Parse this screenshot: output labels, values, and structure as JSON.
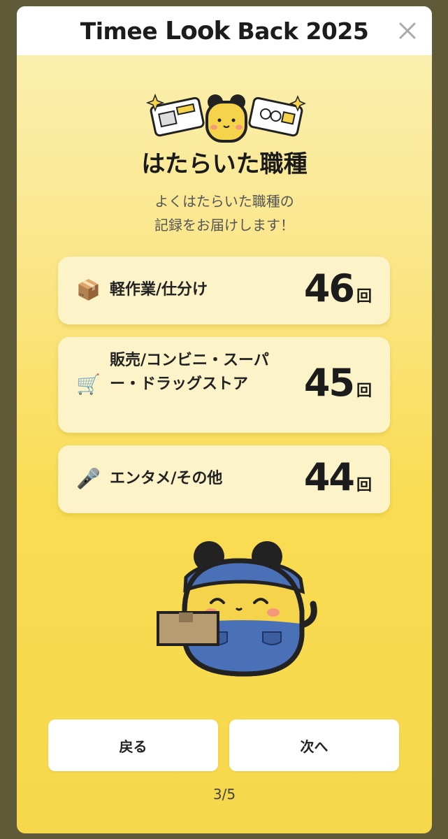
{
  "header": {
    "logo_part1": "Timee ",
    "logo_part2": "Look",
    "logo_part3": " Back ",
    "logo_year": "2025",
    "close_label": "×"
  },
  "section": {
    "title": "はたらいた職種",
    "subtitle": "よくはたらいた職種の\n記録をお届けします！"
  },
  "jobs": [
    {
      "icon": "📦",
      "icon_name": "package-icon",
      "label": "軽作業/仕分け",
      "count": "46",
      "unit": "回"
    },
    {
      "icon": "🛒",
      "icon_name": "shopping-cart-icon",
      "label": "販売/コンビニ・スーパー・ドラッグストア",
      "count": "45",
      "unit": "回"
    },
    {
      "icon": "🎤",
      "icon_name": "microphone-icon",
      "label": "エンタメ/その他",
      "count": "44",
      "unit": "回"
    }
  ],
  "buttons": {
    "back": "戻る",
    "next": "次へ"
  },
  "pager": "3/5",
  "colors": {
    "accent": "#f7d84c",
    "card": "#fcf3c8",
    "mascot_blue": "#4a70b8"
  }
}
